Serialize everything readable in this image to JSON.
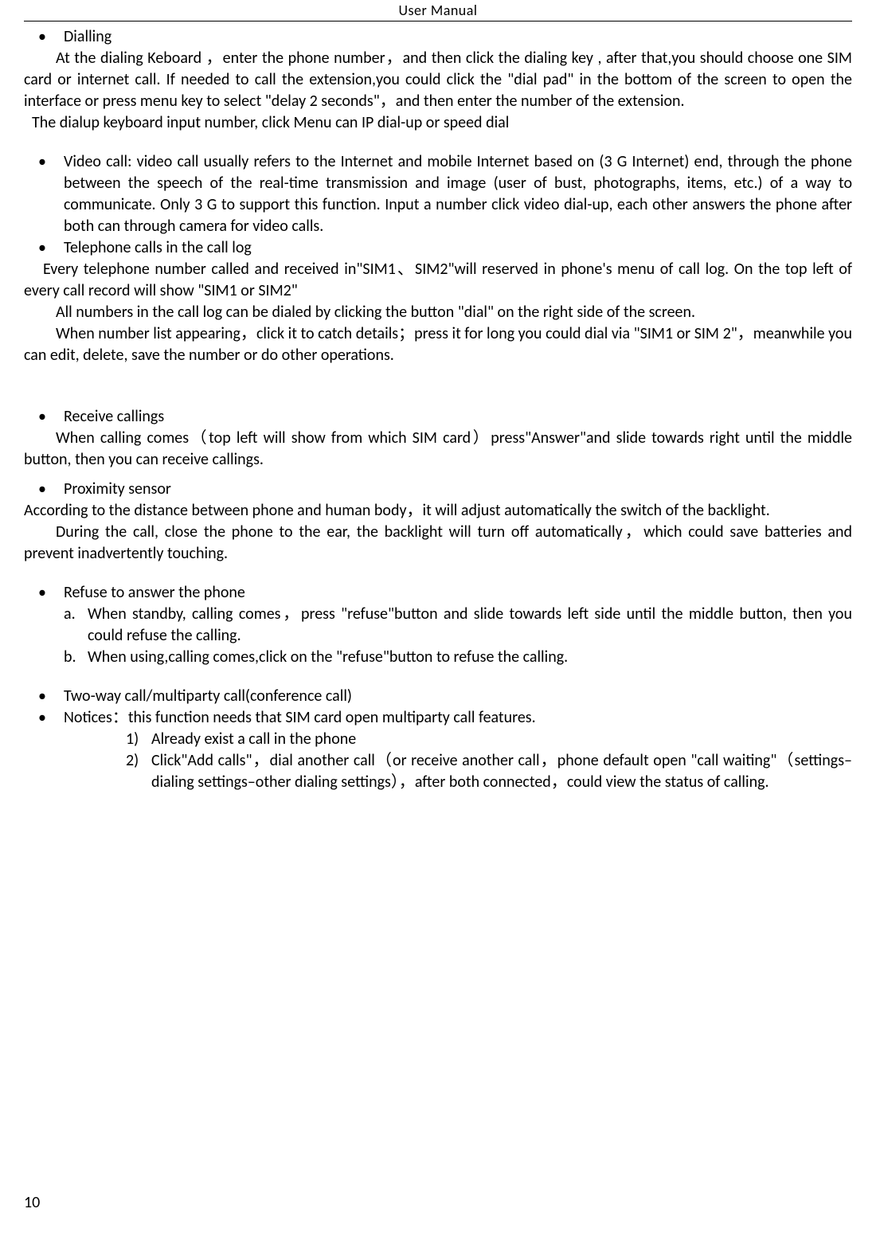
{
  "header": "User    Manual",
  "pageNumber": "10",
  "items": {
    "dialling": {
      "title": "Dialling",
      "p1": "At the dialing Keboard ，enter the phone number，and then click the dialing key , after that,you should choose one SIM card or internet call. If needed to call the extension,you could click the \"dial pad\" in the bottom of the screen to open the interface or press menu key to select \"delay 2 seconds\"，and then enter the number of the extension.",
      "p2": "The dialup keyboard input number, click Menu can IP dial-up or speed dial"
    },
    "videocall": "Video call: video call usually refers to the Internet and mobile Internet based on (3 G Internet) end, through the phone between the speech of the real-time transmission and image (user of bust, photographs, items, etc.) of a way to communicate. Only 3 G to support this function. Input a number click video dial-up, each other answers the phone after both can through camera for video calls.",
    "calllog": {
      "title": "Telephone calls in the call log",
      "p1": "Every telephone number called and received in\"SIM1、SIM2\"will reserved in phone's menu of call log. On the top left of every call record will show \"SIM1 or SIM2\"",
      "p2": "All numbers in the call log can be dialed by clicking the button \"dial\" on the right side of the screen.",
      "p3": "When number list appearing，click it to catch details；press it for long you could dial via \"SIM1 or SIM 2\"，meanwhile you can edit, delete, save the number or do other operations."
    },
    "receive": {
      "title": "Receive callings",
      "p1": "When calling comes（top left will show from which SIM card）press\"Answer\"and slide towards right until the middle button, then you can receive callings."
    },
    "proximity": {
      "title": "Proximity sensor",
      "p1": "According to the distance between phone and human body，it will adjust automatically the switch of the backlight.",
      "p2": "During the call, close the phone to the ear, the backlight will turn off automatically，which could save batteries and prevent inadvertently touching."
    },
    "refuse": {
      "title": "Refuse to answer the phone",
      "a": "When standby, calling comes，press \"refuse\"button and slide towards left side until the middle button, then you could refuse the calling.",
      "b": "When using,calling comes,click on the \"refuse\"button to refuse the calling."
    },
    "twoway": "Two-way call/multiparty call(conference call)",
    "notices": {
      "title": "Notices：this function needs that SIM card open multiparty call features.",
      "n1": "Already exist a call in the phone",
      "n2": "Click\"Add calls\"，dial another call（or receive another call，phone default open \"call waiting\"（settings–dialing settings–other dialing settings），after both connected，could view the status of calling."
    }
  }
}
